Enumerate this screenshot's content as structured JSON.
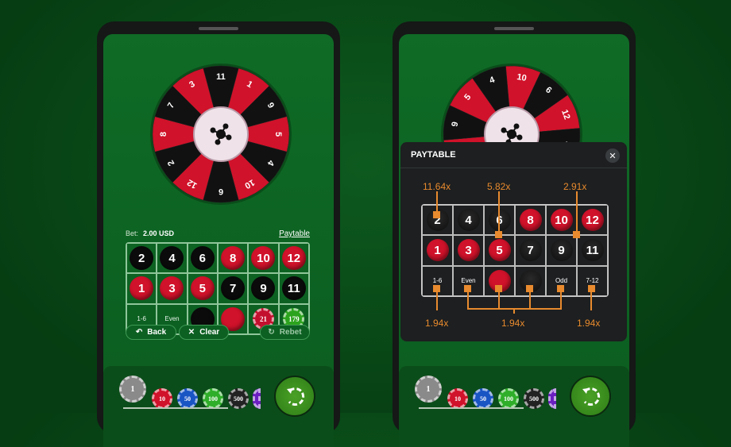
{
  "wheel": {
    "numbers": [
      "11",
      "1",
      "9",
      "5",
      "4",
      "10",
      "6",
      "12",
      "2",
      "8",
      "7",
      "3"
    ],
    "colors": [
      "black",
      "red",
      "black",
      "red",
      "black",
      "red",
      "black",
      "red",
      "black",
      "red",
      "black",
      "red"
    ]
  },
  "bet": {
    "label": "Bet:",
    "value": "2.00 USD",
    "paytable_link": "Paytable"
  },
  "board": {
    "rows": [
      [
        "2",
        "4",
        "6",
        "8",
        "10",
        "12"
      ],
      [
        "1",
        "3",
        "5",
        "7",
        "9",
        "11"
      ]
    ],
    "row_colors": [
      [
        "k",
        "k",
        "k",
        "r",
        "r",
        "r"
      ],
      [
        "r",
        "r",
        "r",
        "k",
        "k",
        "k"
      ]
    ],
    "bottom": [
      "1-6",
      "Even",
      "",
      "",
      "",
      "7-12"
    ],
    "bottom_paytable": [
      "1-6",
      "Even",
      "",
      "",
      "Odd",
      "7-12"
    ],
    "placed_chips": [
      {
        "value": "21",
        "color": "#c4102f"
      },
      {
        "value": "179",
        "color": "#2ca31d"
      }
    ]
  },
  "buttons": {
    "back": "Back",
    "clear": "Clear",
    "rebet": "Rebet"
  },
  "chips": [
    {
      "value": "1",
      "color": "#8a8a8a"
    },
    {
      "value": "10",
      "color": "#d0122a"
    },
    {
      "value": "50",
      "color": "#1a55c4"
    },
    {
      "value": "100",
      "color": "#2fae2a"
    },
    {
      "value": "500",
      "color": "#222222"
    },
    {
      "value": "1000",
      "color": "#6a1fc0"
    }
  ],
  "paytable": {
    "title": "PAYTABLE",
    "multipliers": {
      "straight": "11.64x",
      "split": "5.82x",
      "corner": "2.91x",
      "low": "1.94x",
      "even_color_odd": "1.94x",
      "high": "1.94x"
    }
  },
  "colors": {
    "red": "#d0122a",
    "black": "#0b0b0b",
    "felt": "#0f6b26",
    "accent": "#e88a2e"
  }
}
